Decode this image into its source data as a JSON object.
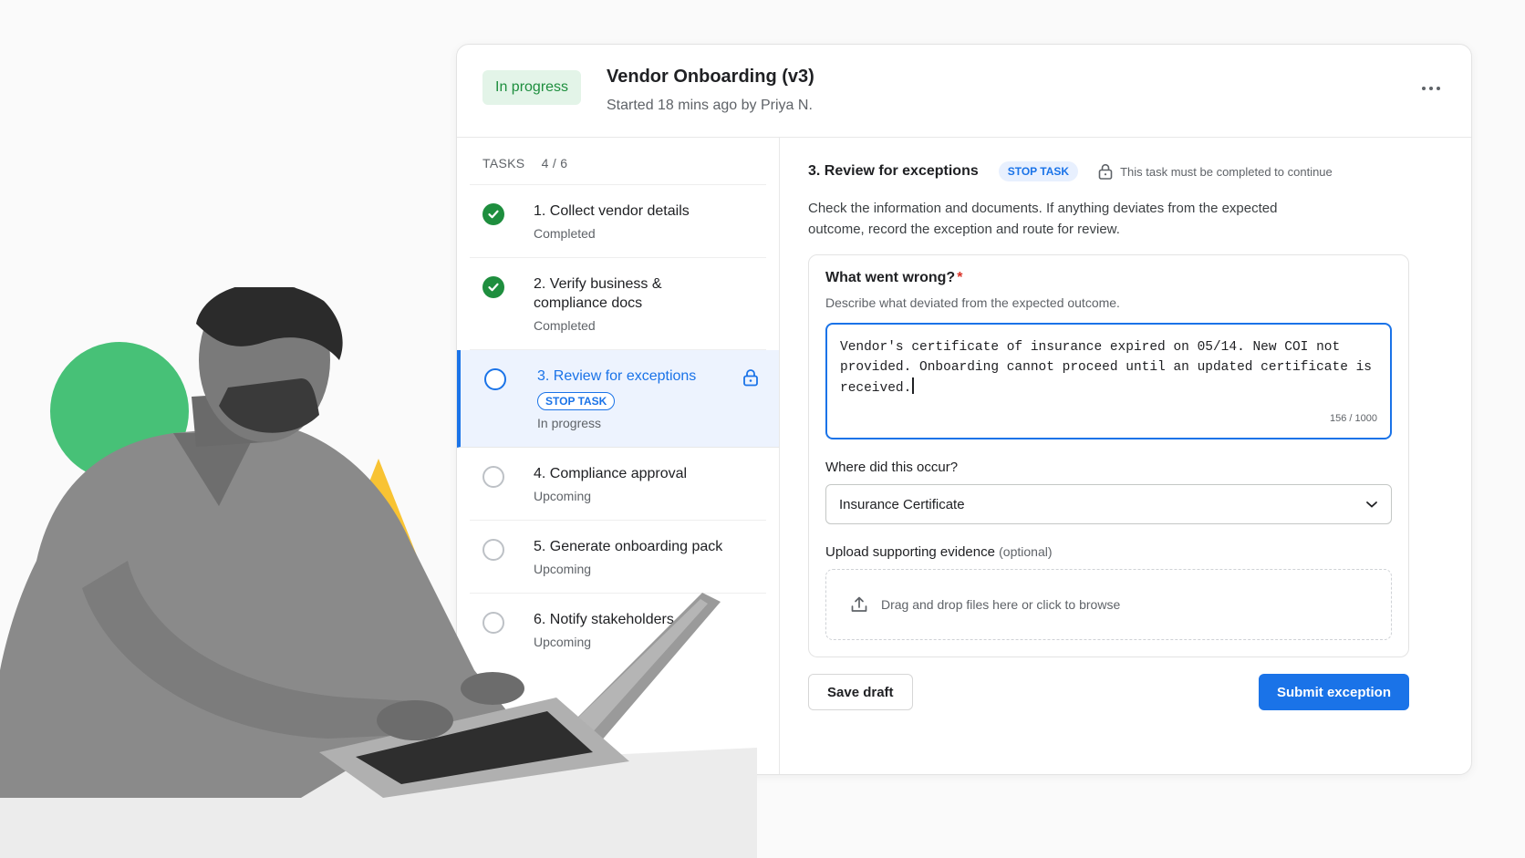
{
  "header": {
    "status": "In progress",
    "title": "Vendor Onboarding (v3)",
    "subtitle": "Started 18 mins ago by Priya N.",
    "more_icon": "more-horizontal-icon"
  },
  "tasks": {
    "heading": "TASKS",
    "count": "4 / 6",
    "items": [
      {
        "title": "1. Collect vendor details",
        "status": "Completed",
        "state": "done"
      },
      {
        "title": "2. Verify business & compliance docs",
        "status": "Completed",
        "state": "done"
      },
      {
        "title": "3. Review for exceptions",
        "status": "In progress",
        "state": "current",
        "chip": "STOP TASK",
        "locked": true
      },
      {
        "title": "4. Compliance approval",
        "status": "Upcoming",
        "state": "todo"
      },
      {
        "title": "5. Generate onboarding pack",
        "status": "Upcoming",
        "state": "todo"
      },
      {
        "title": "6. Notify stakeholders",
        "status": "Upcoming",
        "state": "todo"
      }
    ]
  },
  "detail": {
    "title": "3. Review for exceptions",
    "chip": "STOP TASK",
    "lock_note": "This task must be completed to continue",
    "description": "Check the information and documents. If anything deviates from the expected outcome, record the exception and route for review.",
    "form": {
      "question_label": "What went wrong?",
      "required_mark": "*",
      "question_help": "Describe what deviated from the expected outcome.",
      "answer_value": "Vendor's certificate of insurance expired on 05/14. New COI not provided. Onboarding cannot proceed until an updated certificate is received.",
      "char_count": "156 / 1000",
      "location_label": "Where did this occur?",
      "location_value": "Insurance Certificate",
      "upload_label": "Upload supporting evidence",
      "upload_optional": "(optional)",
      "upload_hint": "Drag and drop files here or click to browse"
    },
    "actions": {
      "save_label": "Save draft",
      "submit_label": "Submit exception"
    }
  },
  "colors": {
    "accent": "#1a73e8",
    "success": "#1e8e3e",
    "success_bg": "#e3f4e8",
    "deco_green": "#47c177",
    "deco_yellow": "#f8c333"
  }
}
